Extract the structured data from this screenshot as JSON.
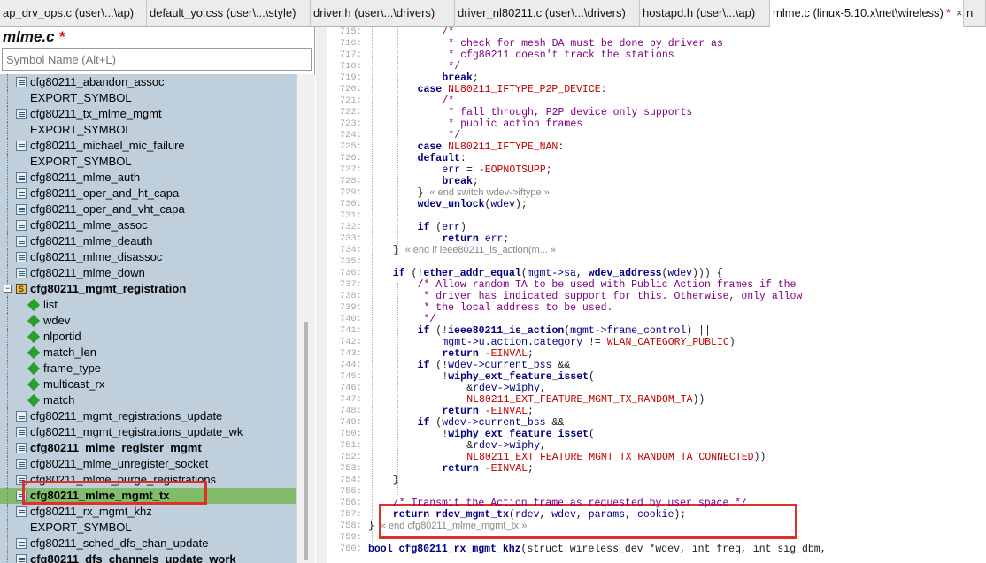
{
  "tabs": [
    {
      "label": "ap_drv_ops.c (user\\...\\ap)",
      "active": false
    },
    {
      "label": "default_yo.css (user\\...\\style)",
      "active": false
    },
    {
      "label": "driver.h (user\\...\\drivers)",
      "active": false
    },
    {
      "label": "driver_nl80211.c (user\\...\\drivers)",
      "active": false
    },
    {
      "label": "hostapd.h (user\\...\\ap)",
      "active": false
    },
    {
      "label": "mlme.c (linux-5.10.x\\net\\wireless)",
      "active": true,
      "modified": "*",
      "close": "×"
    },
    {
      "label": "n",
      "active": false
    }
  ],
  "symbol_panel": {
    "file_name": "mlme.c",
    "modified_mark": "*",
    "search_placeholder": "Symbol Name (Alt+L)",
    "items": [
      {
        "label": "cfg80211_abandon_assoc",
        "kind": "function",
        "level": 0
      },
      {
        "label": "EXPORT_SYMBOL",
        "kind": "macro",
        "level": 0
      },
      {
        "label": "cfg80211_tx_mlme_mgmt",
        "kind": "function",
        "level": 0
      },
      {
        "label": "EXPORT_SYMBOL",
        "kind": "macro",
        "level": 0
      },
      {
        "label": "cfg80211_michael_mic_failure",
        "kind": "function",
        "level": 0
      },
      {
        "label": "EXPORT_SYMBOL",
        "kind": "macro",
        "level": 0
      },
      {
        "label": "cfg80211_mlme_auth",
        "kind": "function",
        "level": 0
      },
      {
        "label": "cfg80211_oper_and_ht_capa",
        "kind": "function",
        "level": 0
      },
      {
        "label": "cfg80211_oper_and_vht_capa",
        "kind": "function",
        "level": 0
      },
      {
        "label": "cfg80211_mlme_assoc",
        "kind": "function",
        "level": 0
      },
      {
        "label": "cfg80211_mlme_deauth",
        "kind": "function",
        "level": 0
      },
      {
        "label": "cfg80211_mlme_disassoc",
        "kind": "function",
        "level": 0
      },
      {
        "label": "cfg80211_mlme_down",
        "kind": "function",
        "level": 0
      },
      {
        "label": "cfg80211_mgmt_registration",
        "kind": "struct",
        "level": 0,
        "bold": true,
        "expanded": true
      },
      {
        "label": "list",
        "kind": "member",
        "level": 1
      },
      {
        "label": "wdev",
        "kind": "member",
        "level": 1
      },
      {
        "label": "nlportid",
        "kind": "member",
        "level": 1
      },
      {
        "label": "match_len",
        "kind": "member",
        "level": 1
      },
      {
        "label": "frame_type",
        "kind": "member",
        "level": 1
      },
      {
        "label": "multicast_rx",
        "kind": "member",
        "level": 1
      },
      {
        "label": "match",
        "kind": "member",
        "level": 1
      },
      {
        "label": "cfg80211_mgmt_registrations_update",
        "kind": "function",
        "level": 0
      },
      {
        "label": "cfg80211_mgmt_registrations_update_wk",
        "kind": "function",
        "level": 0
      },
      {
        "label": "cfg80211_mlme_register_mgmt",
        "kind": "function",
        "level": 0,
        "bold": true
      },
      {
        "label": "cfg80211_mlme_unregister_socket",
        "kind": "function",
        "level": 0
      },
      {
        "label": "cfg80211_mlme_purge_registrations",
        "kind": "function",
        "level": 0
      },
      {
        "label": "cfg80211_mlme_mgmt_tx",
        "kind": "function",
        "level": 0,
        "bold": true,
        "selected": true
      },
      {
        "label": "cfg80211_rx_mgmt_khz",
        "kind": "function",
        "level": 0
      },
      {
        "label": "EXPORT_SYMBOL",
        "kind": "macro",
        "level": 0
      },
      {
        "label": "cfg80211_sched_dfs_chan_update",
        "kind": "function",
        "level": 0
      },
      {
        "label": "cfg80211_dfs_channels_update_work",
        "kind": "function",
        "level": 0,
        "bold": true
      }
    ]
  },
  "code": {
    "lines": [
      {
        "n": "715:",
        "ind": 12,
        "parts": [
          [
            "cm",
            "/*"
          ]
        ]
      },
      {
        "n": "716:",
        "ind": 12,
        "parts": [
          [
            "cm",
            " * check for mesh DA must be done by driver as"
          ]
        ]
      },
      {
        "n": "717:",
        "ind": 12,
        "parts": [
          [
            "cm",
            " * cfg80211 doesn't track the stations"
          ]
        ]
      },
      {
        "n": "718:",
        "ind": 12,
        "parts": [
          [
            "cm",
            " */"
          ]
        ]
      },
      {
        "n": "719:",
        "ind": 12,
        "parts": [
          [
            "kw",
            "break"
          ],
          [
            "",
            ";"
          ]
        ]
      },
      {
        "n": "720:",
        "ind": 8,
        "parts": [
          [
            "kw",
            "case"
          ],
          [
            "",
            " "
          ],
          [
            "cn",
            "NL80211_IFTYPE_P2P_DEVICE"
          ],
          [
            "",
            ":"
          ]
        ]
      },
      {
        "n": "721:",
        "ind": 12,
        "parts": [
          [
            "cm",
            "/*"
          ]
        ]
      },
      {
        "n": "722:",
        "ind": 12,
        "parts": [
          [
            "cm",
            " * fall through, P2P device only supports"
          ]
        ]
      },
      {
        "n": "723:",
        "ind": 12,
        "parts": [
          [
            "cm",
            " * public action frames"
          ]
        ]
      },
      {
        "n": "724:",
        "ind": 12,
        "parts": [
          [
            "cm",
            " */"
          ]
        ]
      },
      {
        "n": "725:",
        "ind": 8,
        "parts": [
          [
            "kw",
            "case"
          ],
          [
            "",
            " "
          ],
          [
            "cn",
            "NL80211_IFTYPE_NAN"
          ],
          [
            "",
            ":"
          ]
        ]
      },
      {
        "n": "726:",
        "ind": 8,
        "parts": [
          [
            "kw",
            "default"
          ],
          [
            "",
            ":"
          ]
        ]
      },
      {
        "n": "727:",
        "ind": 12,
        "parts": [
          [
            "vr",
            "err"
          ],
          [
            "",
            " = -"
          ],
          [
            "cn",
            "EOPNOTSUPP"
          ],
          [
            "",
            ";"
          ]
        ]
      },
      {
        "n": "728:",
        "ind": 12,
        "parts": [
          [
            "kw",
            "break"
          ],
          [
            "",
            ";"
          ]
        ]
      },
      {
        "n": "729:",
        "ind": 8,
        "parts": [
          [
            "",
            "} "
          ],
          [
            "endc",
            "« end switch wdev->iftype »"
          ]
        ]
      },
      {
        "n": "730:",
        "ind": 8,
        "parts": [
          [
            "fn",
            "wdev_unlock"
          ],
          [
            "",
            "("
          ],
          [
            "vr",
            "wdev"
          ],
          [
            "",
            ");"
          ]
        ]
      },
      {
        "n": "731:",
        "ind": 0,
        "parts": []
      },
      {
        "n": "732:",
        "ind": 8,
        "parts": [
          [
            "kw",
            "if"
          ],
          [
            "",
            " ("
          ],
          [
            "vr",
            "err"
          ],
          [
            "",
            ")"
          ]
        ]
      },
      {
        "n": "733:",
        "ind": 12,
        "parts": [
          [
            "kw",
            "return"
          ],
          [
            "",
            " "
          ],
          [
            "vr",
            "err"
          ],
          [
            "",
            ";"
          ]
        ]
      },
      {
        "n": "734:",
        "ind": 4,
        "parts": [
          [
            "",
            "} "
          ],
          [
            "endc",
            "« end if ieee80211_is_action(m... »"
          ]
        ]
      },
      {
        "n": "735:",
        "ind": 0,
        "parts": []
      },
      {
        "n": "736:",
        "ind": 4,
        "parts": [
          [
            "kw",
            "if"
          ],
          [
            "",
            " (!"
          ],
          [
            "fn",
            "ether_addr_equal"
          ],
          [
            "",
            "("
          ],
          [
            "vr",
            "mgmt->sa"
          ],
          [
            "",
            ", "
          ],
          [
            "fn",
            "wdev_address"
          ],
          [
            "",
            "("
          ],
          [
            "vr",
            "wdev"
          ],
          [
            "",
            "))) {"
          ]
        ]
      },
      {
        "n": "737:",
        "ind": 8,
        "parts": [
          [
            "cm",
            "/* Allow random TA to be used with Public Action frames if the"
          ]
        ]
      },
      {
        "n": "738:",
        "ind": 8,
        "parts": [
          [
            "cm",
            " * driver has indicated support for this. Otherwise, only allow"
          ]
        ]
      },
      {
        "n": "739:",
        "ind": 8,
        "parts": [
          [
            "cm",
            " * the local address to be used."
          ]
        ]
      },
      {
        "n": "740:",
        "ind": 8,
        "parts": [
          [
            "cm",
            " */"
          ]
        ]
      },
      {
        "n": "741:",
        "ind": 8,
        "parts": [
          [
            "kw",
            "if"
          ],
          [
            "",
            " (!"
          ],
          [
            "fn",
            "ieee80211_is_action"
          ],
          [
            "",
            "("
          ],
          [
            "vr",
            "mgmt->frame_control"
          ],
          [
            "",
            ") ||"
          ]
        ]
      },
      {
        "n": "742:",
        "ind": 12,
        "parts": [
          [
            "vr",
            "mgmt->u.action.category"
          ],
          [
            "",
            " != "
          ],
          [
            "cn",
            "WLAN_CATEGORY_PUBLIC"
          ],
          [
            "",
            ")"
          ]
        ]
      },
      {
        "n": "743:",
        "ind": 12,
        "parts": [
          [
            "kw",
            "return"
          ],
          [
            "",
            " -"
          ],
          [
            "cn",
            "EINVAL"
          ],
          [
            "",
            ";"
          ]
        ]
      },
      {
        "n": "744:",
        "ind": 8,
        "parts": [
          [
            "kw",
            "if"
          ],
          [
            "",
            " (!"
          ],
          [
            "vr",
            "wdev->current_bss"
          ],
          [
            "",
            " &&"
          ]
        ]
      },
      {
        "n": "745:",
        "ind": 12,
        "parts": [
          [
            "",
            "!"
          ],
          [
            "fn",
            "wiphy_ext_feature_isset"
          ],
          [
            "",
            "("
          ]
        ]
      },
      {
        "n": "746:",
        "ind": 16,
        "parts": [
          [
            "",
            "&"
          ],
          [
            "vr",
            "rdev->wiphy"
          ],
          [
            "",
            ","
          ]
        ]
      },
      {
        "n": "747:",
        "ind": 16,
        "parts": [
          [
            "cn",
            "NL80211_EXT_FEATURE_MGMT_TX_RANDOM_TA"
          ],
          [
            "",
            "))"
          ]
        ]
      },
      {
        "n": "748:",
        "ind": 12,
        "parts": [
          [
            "kw",
            "return"
          ],
          [
            "",
            " -"
          ],
          [
            "cn",
            "EINVAL"
          ],
          [
            "",
            ";"
          ]
        ]
      },
      {
        "n": "749:",
        "ind": 8,
        "parts": [
          [
            "kw",
            "if"
          ],
          [
            "",
            " ("
          ],
          [
            "vr",
            "wdev->current_bss"
          ],
          [
            "",
            " &&"
          ]
        ]
      },
      {
        "n": "750:",
        "ind": 12,
        "parts": [
          [
            "",
            "!"
          ],
          [
            "fn",
            "wiphy_ext_feature_isset"
          ],
          [
            "",
            "("
          ]
        ]
      },
      {
        "n": "751:",
        "ind": 16,
        "parts": [
          [
            "",
            "&"
          ],
          [
            "vr",
            "rdev->wiphy"
          ],
          [
            "",
            ","
          ]
        ]
      },
      {
        "n": "752:",
        "ind": 16,
        "parts": [
          [
            "cn",
            "NL80211_EXT_FEATURE_MGMT_TX_RANDOM_TA_CONNECTED"
          ],
          [
            "",
            "))"
          ]
        ]
      },
      {
        "n": "753:",
        "ind": 12,
        "parts": [
          [
            "kw",
            "return"
          ],
          [
            "",
            " -"
          ],
          [
            "cn",
            "EINVAL"
          ],
          [
            "",
            ";"
          ]
        ]
      },
      {
        "n": "754:",
        "ind": 4,
        "parts": [
          [
            "",
            "}"
          ]
        ]
      },
      {
        "n": "755:",
        "ind": 0,
        "parts": []
      },
      {
        "n": "756:",
        "ind": 4,
        "parts": [
          [
            "cm",
            "/* Transmit the Action frame as requested by user space */"
          ]
        ]
      },
      {
        "n": "757:",
        "ind": 4,
        "parts": [
          [
            "kw",
            "return"
          ],
          [
            "",
            " "
          ],
          [
            "fn",
            "rdev_mgmt_tx"
          ],
          [
            "",
            "("
          ],
          [
            "vr",
            "rdev"
          ],
          [
            "",
            ", "
          ],
          [
            "vr",
            "wdev"
          ],
          [
            "",
            ", "
          ],
          [
            "vr",
            "params"
          ],
          [
            "",
            ", "
          ],
          [
            "vr",
            "cookie"
          ],
          [
            "",
            ");"
          ]
        ]
      },
      {
        "n": "758:",
        "ind": 0,
        "parts": [
          [
            "",
            "} "
          ],
          [
            "endc",
            "« end cfg80211_mlme_mgmt_tx »"
          ]
        ]
      },
      {
        "n": "759:",
        "ind": 0,
        "parts": []
      },
      {
        "n": "760:",
        "ind": 0,
        "parts": [
          [
            "kw",
            "bool"
          ],
          [
            "",
            " "
          ],
          [
            "fn",
            "cfg80211_rx_mgmt_khz"
          ],
          [
            "",
            "(struct wireless_dev *wdev, int freq, int sig_dbm,"
          ]
        ]
      }
    ]
  },
  "colors": {
    "symbol_list_bg": "#bfcfdb",
    "selected_row": "#80bc69",
    "highlight_box": "#e0302a",
    "keyword": "#000080",
    "comment": "#800080",
    "constant": "#c00000"
  }
}
